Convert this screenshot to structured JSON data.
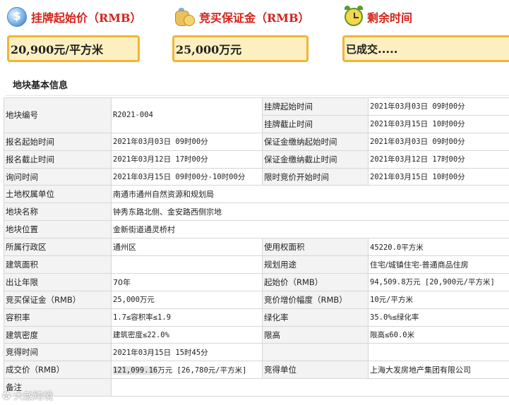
{
  "header": {
    "listing_price": {
      "icon": "dollar-coin-icon",
      "title": "挂牌起始价（RMB）",
      "value": "20,900元/平方米"
    },
    "deposit": {
      "icon": "money-bag-icon",
      "title": "竞买保证金（RMB）",
      "value": "25,000万元"
    },
    "remaining": {
      "icon": "alarm-clock-icon",
      "title": "剩余时间",
      "value": "已成交....."
    }
  },
  "colors": {
    "accent_red": "#d4221a",
    "box_fill": "#fdefc0",
    "box_border": "#f2b437"
  },
  "section": {
    "title": "地块基本信息"
  },
  "info": {
    "r1": {
      "l1": "地块编号",
      "v1": "R2021-004",
      "l2": "挂牌起始时间",
      "v2": "2021年03月03日 09时00分"
    },
    "r2": {
      "l2": "挂牌截止时间",
      "v2": "2021年03月15日 10时00分"
    },
    "r3": {
      "l1": "报名起始时间",
      "v1": "2021年03月03日 09时00分",
      "l2": "保证金缴纳起始时间",
      "v2": "2021年03月03日 09时00分"
    },
    "r4": {
      "l1": "报名截止时间",
      "v1": "2021年03月12日 17时00分",
      "l2": "保证金缴纳截止时间",
      "v2": "2021年03月12日 17时00分"
    },
    "r5": {
      "l1": "询问时间",
      "v1": "2021年03月15日 09时00分-10时00分",
      "l2": "限时竞价开始时间",
      "v2": "2021年03月15日 10时00分"
    },
    "r6": {
      "l1": "土地权属单位",
      "v1": "南通市通州自然资源和规划局"
    },
    "r7": {
      "l1": "地块名称",
      "v1": "钟秀东路北侧、金安路西侧宗地"
    },
    "r8": {
      "l1": "地块位置",
      "v1": "金新街道通灵桥村"
    },
    "r9": {
      "l1": "所属行政区",
      "v1": "通州区",
      "l2": "使用权面积",
      "v2": "45220.0平方米"
    },
    "r10": {
      "l1": "建筑面积",
      "v1": "",
      "l2": "规划用途",
      "v2": "住宅/城镇住宅-普通商品住房"
    },
    "r11": {
      "l1": "出让年限",
      "v1": "70年",
      "l2": "起始价（RMB）",
      "v2": "94,509.8万元 [20,900元/平方米]"
    },
    "r12": {
      "l1": "竞买保证金（RMB）",
      "v1": "25,000万元",
      "l2": "竞价增价幅度（RMB）",
      "v2": "10元/平方米"
    },
    "r13": {
      "l1": "容积率",
      "v1": "1.7≤容积率≤1.9",
      "l2": "绿化率",
      "v2": "35.0%≤绿化率"
    },
    "r14": {
      "l1": "建筑密度",
      "v1": "建筑密度≤22.0%",
      "l2": "限高",
      "v2": "限高≤60.0米"
    },
    "r15": {
      "l1": "竞得时间",
      "v1": "2021年03月15日 15时45分",
      "l2": "",
      "v2": ""
    },
    "r16": {
      "l1": "成交价（RMB）",
      "v1a": "121,099.16",
      "v1b": "万元 [26,780元/平方米]",
      "l2": "竞得单位",
      "v2": "上海大发房地产集团有限公司"
    },
    "r17": {
      "l1": "备注",
      "v1": ""
    }
  },
  "watermark": "大啟跨境"
}
